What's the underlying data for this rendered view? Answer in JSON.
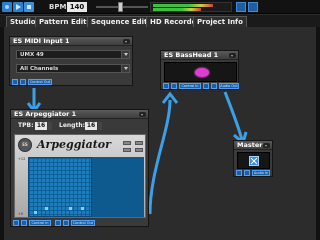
{
  "toolbar": {
    "bpm_label": "BPM:",
    "bpm_value": "140",
    "buttons": [
      "record",
      "play",
      "stop"
    ]
  },
  "tabs": [
    {
      "label": "Studio"
    },
    {
      "label": "Pattern Editor"
    },
    {
      "label": "Sequence Editor"
    },
    {
      "label": "HD Recorder"
    },
    {
      "label": "Project Info"
    }
  ],
  "modules": {
    "midi_input": {
      "title": "ES MIDI Input 1",
      "device": "UMX 49",
      "channel": "All Channels",
      "port_label": "Control Out"
    },
    "bass_head": {
      "title": "ES BassHead 1",
      "ports": [
        "Control In",
        "Audio Out"
      ]
    },
    "arpeggiator": {
      "title": "ES Arpeggiator 1",
      "tpb_label": "TPB:",
      "tpb_value": "16",
      "length_label": "Length:",
      "length_value": "16",
      "face_logo": "ES",
      "face_name": "Arpeggiator",
      "axis_top": "+12",
      "axis_bottom": "+0",
      "ports": [
        "Control In",
        "Control Out"
      ]
    },
    "master": {
      "title": "Master",
      "ports": [
        "Audio In"
      ]
    }
  },
  "colors": {
    "accent": "#2a7fd0",
    "wire": "#3aa0e8",
    "synth": "#e23ad8"
  }
}
